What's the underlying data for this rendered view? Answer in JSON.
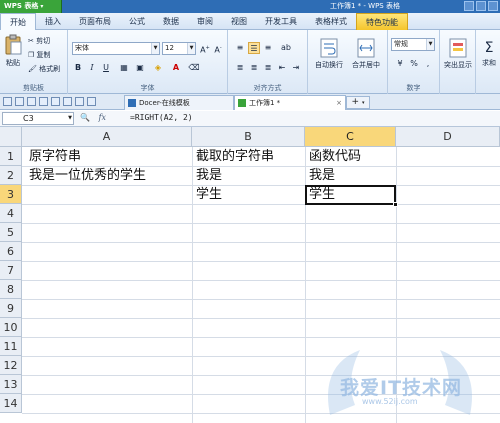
{
  "app": {
    "button_label": "WPS 表格",
    "window_title": "工作簿1 * - WPS 表格"
  },
  "menu": {
    "tabs": [
      "开始",
      "插入",
      "页面布局",
      "公式",
      "数据",
      "审阅",
      "视图",
      "开发工具",
      "表格样式",
      "特色功能"
    ]
  },
  "ribbon": {
    "clipboard": {
      "paste": "粘贴",
      "cut": "剪切",
      "copy": "复制",
      "format_painter": "格式刷",
      "group_label": "剪贴板"
    },
    "font": {
      "name": "宋体",
      "size": "12",
      "group_label": "字体"
    },
    "alignment": {
      "group_label": "对齐方式"
    },
    "wrap": {
      "auto_wrap": "自动换行",
      "merge_center": "合并居中"
    },
    "number": {
      "format": "常规",
      "percent": "%",
      "group_label": "数字"
    },
    "highlight": "突出显示",
    "sum": "求和"
  },
  "doc_tabs": [
    {
      "label": "Docer-在线模板"
    },
    {
      "label": "工作簿1 *"
    }
  ],
  "formula_bar": {
    "cell_ref": "C3",
    "formula": "=RIGHT(A2, 2)"
  },
  "sheet": {
    "columns": [
      "A",
      "B",
      "C",
      "D"
    ],
    "rows": [
      "1",
      "2",
      "3",
      "4",
      "5",
      "6",
      "7",
      "8",
      "9",
      "10",
      "11",
      "12",
      "13",
      "14"
    ],
    "cells": {
      "A1": "原字符串",
      "B1": "截取的字符串",
      "C1": "函数代码",
      "A2": "我是一位优秀的学生",
      "B2": "我是",
      "C2": "我是",
      "B3": "学生",
      "C3": "学生"
    },
    "selected_cell": "C3"
  },
  "watermark": {
    "text": "我爱IT技术网",
    "url": "www.52ij.com"
  },
  "colors": {
    "title_bar": "#2e6db5",
    "app_button": "#3aa43a",
    "selected_header": "#f9d77a",
    "special_tab": "#f5c52c"
  }
}
